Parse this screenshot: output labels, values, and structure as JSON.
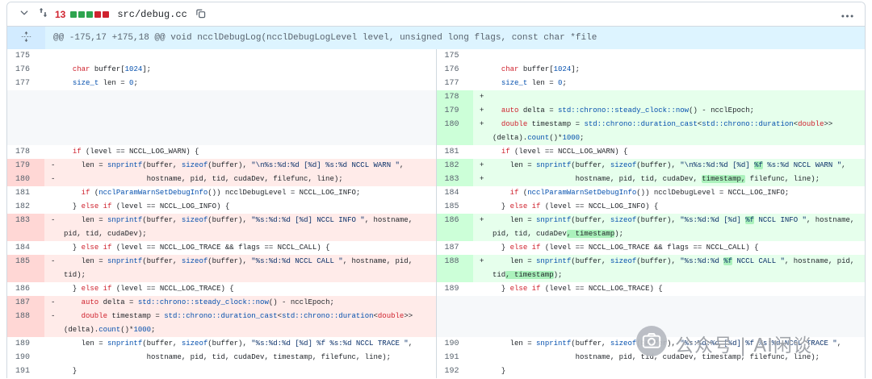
{
  "file_header": {
    "changes_count": "13",
    "diffstat_blocks": [
      "add",
      "add",
      "add",
      "del",
      "del"
    ],
    "filename": "src/debug.cc"
  },
  "hunk": {
    "header": "@@ -175,17 +175,18 @@ void ncclDebugLog(ncclDebugLogLevel level, unsigned long flags, const char *file"
  },
  "colors": {
    "addition_bg": "#e6ffec",
    "addition_gutter": "#ccffd8",
    "addition_word": "#abf2bc",
    "deletion_bg": "#ffebe9",
    "deletion_gutter": "#ffd7d5",
    "hunk_bg": "#ddf4ff",
    "keyword": "#cf222e",
    "constant": "#0550ae",
    "string": "#0a3069"
  },
  "watermark": {
    "text": "公众号 | AI闲谈"
  },
  "diff": {
    "rows": [
      {
        "left": {
          "n": "175",
          "t": "ctx",
          "seg": []
        },
        "right": {
          "n": "175",
          "t": "ctx",
          "seg": []
        }
      },
      {
        "left": {
          "n": "176",
          "t": "ctx",
          "seg": [
            [
              "  ",
              ""
            ],
            [
              "char",
              "k"
            ],
            [
              " buffer[",
              ""
            ],
            [
              "1024",
              "b"
            ],
            [
              "];",
              ""
            ]
          ]
        },
        "right": {
          "n": "176",
          "t": "ctx",
          "seg": [
            [
              "  ",
              ""
            ],
            [
              "char",
              "k"
            ],
            [
              " buffer[",
              ""
            ],
            [
              "1024",
              "b"
            ],
            [
              "];",
              ""
            ]
          ]
        }
      },
      {
        "left": {
          "n": "177",
          "t": "ctx",
          "seg": [
            [
              "  ",
              ""
            ],
            [
              "size_t",
              "b"
            ],
            [
              " len = ",
              ""
            ],
            [
              "0",
              "b"
            ],
            [
              ";",
              ""
            ]
          ]
        },
        "right": {
          "n": "177",
          "t": "ctx",
          "seg": [
            [
              "  ",
              ""
            ],
            [
              "size_t",
              "b"
            ],
            [
              " len = ",
              ""
            ],
            [
              "0",
              "b"
            ],
            [
              ";",
              ""
            ]
          ]
        }
      },
      {
        "left": {
          "t": "empty",
          "seg": []
        },
        "right": {
          "n": "178",
          "t": "add",
          "seg": []
        }
      },
      {
        "left": {
          "t": "empty",
          "seg": []
        },
        "right": {
          "n": "179",
          "t": "add",
          "seg": [
            [
              "  ",
              ""
            ],
            [
              "auto",
              "k"
            ],
            [
              " delta = ",
              ""
            ],
            [
              "std::chrono::steady_clock::now",
              "b"
            ],
            [
              "() - ncclEpoch;",
              ""
            ]
          ]
        }
      },
      {
        "left": {
          "t": "empty",
          "seg": []
        },
        "right": {
          "n": "180",
          "t": "add",
          "seg": [
            [
              "  ",
              ""
            ],
            [
              "double",
              "k"
            ],
            [
              " timestamp = ",
              ""
            ],
            [
              "std::chrono::duration_cast",
              "b"
            ],
            [
              "<",
              ""
            ],
            [
              "std::chrono::duration",
              "b"
            ],
            [
              "<",
              ""
            ],
            [
              "double",
              "k"
            ],
            [
              ">> (delta).",
              ""
            ],
            [
              "count",
              "b"
            ],
            [
              "()*",
              ""
            ],
            [
              "1000",
              "b"
            ],
            [
              ";",
              ""
            ]
          ]
        }
      },
      {
        "left": {
          "n": "178",
          "t": "ctx",
          "seg": [
            [
              "  ",
              ""
            ],
            [
              "if",
              "k"
            ],
            [
              " (level == NCCL_LOG_WARN) {",
              ""
            ]
          ]
        },
        "right": {
          "n": "181",
          "t": "ctx",
          "seg": [
            [
              "  ",
              ""
            ],
            [
              "if",
              "k"
            ],
            [
              " (level == NCCL_LOG_WARN) {",
              ""
            ]
          ]
        }
      },
      {
        "left": {
          "n": "179",
          "t": "del",
          "seg": [
            [
              "    len = ",
              ""
            ],
            [
              "snprintf",
              "b"
            ],
            [
              "(buffer, ",
              ""
            ],
            [
              "sizeof",
              "b"
            ],
            [
              "(buffer), ",
              ""
            ],
            [
              "\"\\n%s:%d:%d [%d] %s:%d NCCL WARN \"",
              "s"
            ],
            [
              ",",
              ""
            ]
          ]
        },
        "right": {
          "n": "182",
          "t": "add",
          "seg": [
            [
              "    len = ",
              ""
            ],
            [
              "snprintf",
              "b"
            ],
            [
              "(buffer, ",
              ""
            ],
            [
              "sizeof",
              "b"
            ],
            [
              "(buffer), ",
              ""
            ],
            [
              "\"\\n%s:%d:%d [%d] ",
              "s"
            ],
            [
              "%f",
              "s hl"
            ],
            [
              " %s:%d NCCL WARN \"",
              "s"
            ],
            [
              ",",
              ""
            ]
          ]
        }
      },
      {
        "left": {
          "n": "180",
          "t": "del",
          "seg": [
            [
              "                   hostname, pid, tid, cudaDev, filefunc, line);",
              ""
            ]
          ]
        },
        "right": {
          "n": "183",
          "t": "add",
          "seg": [
            [
              "                   hostname, pid, tid, cudaDev, ",
              ""
            ],
            [
              "timestamp,",
              "hl"
            ],
            [
              " filefunc, line);",
              ""
            ]
          ]
        }
      },
      {
        "left": {
          "n": "181",
          "t": "ctx",
          "seg": [
            [
              "    ",
              ""
            ],
            [
              "if",
              "k"
            ],
            [
              " (",
              ""
            ],
            [
              "ncclParamWarnSetDebugInfo",
              "b"
            ],
            [
              "()) ncclDebugLevel = NCCL_LOG_INFO;",
              ""
            ]
          ]
        },
        "right": {
          "n": "184",
          "t": "ctx",
          "seg": [
            [
              "    ",
              ""
            ],
            [
              "if",
              "k"
            ],
            [
              " (",
              ""
            ],
            [
              "ncclParamWarnSetDebugInfo",
              "b"
            ],
            [
              "()) ncclDebugLevel = NCCL_LOG_INFO;",
              ""
            ]
          ]
        }
      },
      {
        "left": {
          "n": "182",
          "t": "ctx",
          "seg": [
            [
              "  } ",
              ""
            ],
            [
              "else",
              "k"
            ],
            [
              " ",
              ""
            ],
            [
              "if",
              "k"
            ],
            [
              " (level == NCCL_LOG_INFO) {",
              ""
            ]
          ]
        },
        "right": {
          "n": "185",
          "t": "ctx",
          "seg": [
            [
              "  } ",
              ""
            ],
            [
              "else",
              "k"
            ],
            [
              " ",
              ""
            ],
            [
              "if",
              "k"
            ],
            [
              " (level == NCCL_LOG_INFO) {",
              ""
            ]
          ]
        }
      },
      {
        "left": {
          "n": "183",
          "t": "del",
          "seg": [
            [
              "    len = ",
              ""
            ],
            [
              "snprintf",
              "b"
            ],
            [
              "(buffer, ",
              ""
            ],
            [
              "sizeof",
              "b"
            ],
            [
              "(buffer), ",
              ""
            ],
            [
              "\"%s:%d:%d [%d] NCCL INFO \"",
              "s"
            ],
            [
              ", hostname, pid, tid, cudaDev);",
              ""
            ]
          ]
        },
        "right": {
          "n": "186",
          "t": "add",
          "seg": [
            [
              "    len = ",
              ""
            ],
            [
              "snprintf",
              "b"
            ],
            [
              "(buffer, ",
              ""
            ],
            [
              "sizeof",
              "b"
            ],
            [
              "(buffer), ",
              ""
            ],
            [
              "\"%s:%d:%d [%d] ",
              "s"
            ],
            [
              "%f",
              "s hl"
            ],
            [
              " NCCL INFO \"",
              "s"
            ],
            [
              ", hostname, pid, tid, cudaDev",
              ""
            ],
            [
              ", timestamp",
              "hl"
            ],
            [
              ");",
              ""
            ]
          ]
        }
      },
      {
        "left": {
          "n": "184",
          "t": "ctx",
          "seg": [
            [
              "  } ",
              ""
            ],
            [
              "else",
              "k"
            ],
            [
              " ",
              ""
            ],
            [
              "if",
              "k"
            ],
            [
              " (level == NCCL_LOG_TRACE && flags == NCCL_CALL) {",
              ""
            ]
          ]
        },
        "right": {
          "n": "187",
          "t": "ctx",
          "seg": [
            [
              "  } ",
              ""
            ],
            [
              "else",
              "k"
            ],
            [
              " ",
              ""
            ],
            [
              "if",
              "k"
            ],
            [
              " (level == NCCL_LOG_TRACE && flags == NCCL_CALL) {",
              ""
            ]
          ]
        }
      },
      {
        "left": {
          "n": "185",
          "t": "del",
          "seg": [
            [
              "    len = ",
              ""
            ],
            [
              "snprintf",
              "b"
            ],
            [
              "(buffer, ",
              ""
            ],
            [
              "sizeof",
              "b"
            ],
            [
              "(buffer), ",
              ""
            ],
            [
              "\"%s:%d:%d NCCL CALL \"",
              "s"
            ],
            [
              ", hostname, pid, tid);",
              ""
            ]
          ]
        },
        "right": {
          "n": "188",
          "t": "add",
          "seg": [
            [
              "    len = ",
              ""
            ],
            [
              "snprintf",
              "b"
            ],
            [
              "(buffer, ",
              ""
            ],
            [
              "sizeof",
              "b"
            ],
            [
              "(buffer), ",
              ""
            ],
            [
              "\"%s:%d:%d ",
              "s"
            ],
            [
              "%f",
              "s hl"
            ],
            [
              " NCCL CALL \"",
              "s"
            ],
            [
              ", hostname, pid, tid",
              ""
            ],
            [
              ", timestamp",
              "hl"
            ],
            [
              ");",
              ""
            ]
          ]
        }
      },
      {
        "left": {
          "n": "186",
          "t": "ctx",
          "seg": [
            [
              "  } ",
              ""
            ],
            [
              "else",
              "k"
            ],
            [
              " ",
              ""
            ],
            [
              "if",
              "k"
            ],
            [
              " (level == NCCL_LOG_TRACE) {",
              ""
            ]
          ]
        },
        "right": {
          "n": "189",
          "t": "ctx",
          "seg": [
            [
              "  } ",
              ""
            ],
            [
              "else",
              "k"
            ],
            [
              " ",
              ""
            ],
            [
              "if",
              "k"
            ],
            [
              " (level == NCCL_LOG_TRACE) {",
              ""
            ]
          ]
        }
      },
      {
        "left": {
          "n": "187",
          "t": "del",
          "seg": [
            [
              "    ",
              ""
            ],
            [
              "auto",
              "k"
            ],
            [
              " delta = ",
              ""
            ],
            [
              "std::chrono::steady_clock::now",
              "b"
            ],
            [
              "() - ncclEpoch;",
              ""
            ]
          ]
        },
        "right": {
          "t": "empty",
          "seg": []
        }
      },
      {
        "left": {
          "n": "188",
          "t": "del",
          "seg": [
            [
              "    ",
              ""
            ],
            [
              "double",
              "k"
            ],
            [
              " timestamp = ",
              ""
            ],
            [
              "std::chrono::duration_cast",
              "b"
            ],
            [
              "<",
              ""
            ],
            [
              "std::chrono::duration",
              "b"
            ],
            [
              "<",
              ""
            ],
            [
              "double",
              "k"
            ],
            [
              ">> (delta).",
              ""
            ],
            [
              "count",
              "b"
            ],
            [
              "()*",
              ""
            ],
            [
              "1000",
              "b"
            ],
            [
              ";",
              ""
            ]
          ]
        },
        "right": {
          "t": "empty",
          "seg": []
        }
      },
      {
        "left": {
          "n": "189",
          "t": "ctx",
          "seg": [
            [
              "    len = ",
              ""
            ],
            [
              "snprintf",
              "b"
            ],
            [
              "(buffer, ",
              ""
            ],
            [
              "sizeof",
              "b"
            ],
            [
              "(buffer), ",
              ""
            ],
            [
              "\"%s:%d:%d [%d] %f %s:%d NCCL TRACE \"",
              "s"
            ],
            [
              ",",
              ""
            ]
          ]
        },
        "right": {
          "n": "190",
          "t": "ctx",
          "seg": [
            [
              "    len = ",
              ""
            ],
            [
              "snprintf",
              "b"
            ],
            [
              "(buffer, ",
              ""
            ],
            [
              "sizeof",
              "b"
            ],
            [
              "(buffer), ",
              ""
            ],
            [
              "\"%s:%d:%d [%d] %f %s:%d NCCL TRACE \"",
              "s"
            ],
            [
              ",",
              ""
            ]
          ]
        }
      },
      {
        "left": {
          "n": "190",
          "t": "ctx",
          "seg": [
            [
              "                   hostname, pid, tid, cudaDev, timestamp, filefunc, line);",
              ""
            ]
          ]
        },
        "right": {
          "n": "191",
          "t": "ctx",
          "seg": [
            [
              "                   hostname, pid, tid, cudaDev, timestamp, filefunc, line);",
              ""
            ]
          ]
        }
      },
      {
        "left": {
          "n": "191",
          "t": "ctx",
          "seg": [
            [
              "  }",
              ""
            ]
          ]
        },
        "right": {
          "n": "192",
          "t": "ctx",
          "seg": [
            [
              "  }",
              ""
            ]
          ]
        }
      }
    ]
  }
}
